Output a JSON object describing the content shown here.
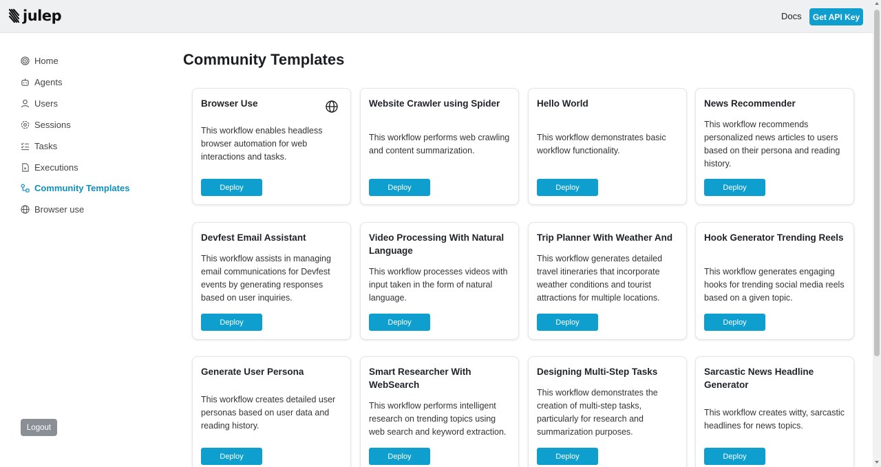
{
  "brand": {
    "name": "julep"
  },
  "header": {
    "docs_label": "Docs",
    "api_key_label": "Get API Key"
  },
  "sidebar": {
    "items": [
      {
        "label": "Home",
        "icon": "target-icon",
        "active": false
      },
      {
        "label": "Agents",
        "icon": "robot-icon",
        "active": false
      },
      {
        "label": "Users",
        "icon": "user-icon",
        "active": false
      },
      {
        "label": "Sessions",
        "icon": "settings-icon",
        "active": false
      },
      {
        "label": "Tasks",
        "icon": "checklist-icon",
        "active": false
      },
      {
        "label": "Executions",
        "icon": "file-play-icon",
        "active": false
      },
      {
        "label": "Community Templates",
        "icon": "workflow-icon",
        "active": true
      },
      {
        "label": "Browser use",
        "icon": "globe-icon",
        "active": false
      }
    ],
    "logout_label": "Logout"
  },
  "main": {
    "title": "Community Templates",
    "deploy_label": "Deploy",
    "templates": [
      {
        "title": "Browser Use",
        "description": "This workflow enables headless browser automation for web interactions and tasks.",
        "icon": "globe-icon"
      },
      {
        "title": "Website Crawler using Spider",
        "description": "This workflow performs web crawling and content summarization."
      },
      {
        "title": "Hello World",
        "description": "This workflow demonstrates basic workflow functionality."
      },
      {
        "title": "News Recommender",
        "description": "This workflow recommends personalized news articles to users based on their persona and reading history."
      },
      {
        "title": "Devfest Email Assistant",
        "description": "This workflow assists in managing email communications for Devfest events by generating responses based on user inquiries."
      },
      {
        "title": "Video Processing With Natural Language",
        "description": "This workflow processes videos with input taken in the form of natural language."
      },
      {
        "title": "Trip Planner With Weather And",
        "description": "This workflow generates detailed travel itineraries that incorporate weather conditions and tourist attractions for multiple locations."
      },
      {
        "title": "Hook Generator Trending Reels",
        "description": "This workflow generates engaging hooks for trending social media reels based on a given topic."
      },
      {
        "title": "Generate User Persona",
        "description": "This workflow creates detailed user personas based on user data and reading history."
      },
      {
        "title": "Smart Researcher With WebSearch",
        "description": "This workflow performs intelligent research on trending topics using web search and keyword extraction."
      },
      {
        "title": "Designing Multi-Step Tasks",
        "description": "This workflow demonstrates the creation of multi-step tasks, particularly for research and summarization purposes."
      },
      {
        "title": "Sarcastic News Headline Generator",
        "description": "This workflow creates witty, sarcastic headlines for news topics."
      }
    ]
  },
  "colors": {
    "accent": "#0e9fcf",
    "active_nav": "#0e8fbc",
    "logout": "#8a8f96"
  }
}
